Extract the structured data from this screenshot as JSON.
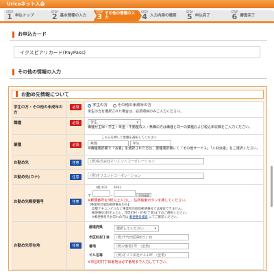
{
  "header": {
    "title": "Uricoネット入会"
  },
  "steps": [
    {
      "label_small": "STEP",
      "num": "1",
      "label": "申込トップ"
    },
    {
      "label_small": "STEP",
      "num": "2",
      "label": "基本情報の入力"
    },
    {
      "label_small": "STEP",
      "num": "3",
      "label": "その他の情報の入力"
    },
    {
      "label_small": "STEP",
      "num": "4",
      "label": "入力内容の確認"
    },
    {
      "label_small": "STEP",
      "num": "5",
      "label": "申込完了"
    },
    {
      "label_small": "STEP",
      "num": "6",
      "label": "審査完了"
    }
  ],
  "card_section": {
    "title": "お申込カード",
    "card_name": "イクスピアリカード(PayPass)"
  },
  "other_section": {
    "title": "その他の情報の入力"
  },
  "work_section": {
    "title": "お勤め先情報について",
    "badges": {
      "required": "必須",
      "optional": "任意"
    },
    "rows": {
      "student": {
        "label": "学生の方・その他の未成年の方",
        "option_on": "学生の方",
        "option_off": "その他の未成年の方",
        "note": "学生の方を選択された場合は、必須項目のみご入力ください。"
      },
      "occupation": {
        "label": "職種",
        "select_value": "学生",
        "note": "職種が主婦・学生・年金・不動産収入・無職の方は職種と同一の業種および税込年収欄をご入力ください。"
      },
      "industry": {
        "label": "業種",
        "hint": "こちらを押して業種を選択してください",
        "value_left": "無職",
        "value_right": "学生",
        "note": "※職種選択欄で「派遣」を選択された方は、業種選択欄にて「その他サービス」「人材派遣」をご選択ください。"
      },
      "company": {
        "label": "お勤め先",
        "placeholder": "(例)株式会社オリエントコーポレーション"
      },
      "company_kana": {
        "label": "お勤め先(カナ)",
        "placeholder": "(例)オリエントコーポレーション"
      },
      "postal": {
        "label": "お勤め先郵便番号",
        "example": "(例)102　　0083",
        "prefix": "〒",
        "dash": "-",
        "search_btn": "住所検索",
        "warn": "※郵便番号を3桁以上入力し、住所検索ボタンを押してください。",
        "notes": [
          "【事業所の個別郵便番号の方】",
          "高層ナチュンビルなど事業所の個別郵便番号では検索できません。",
          "郵便番号3桁を入力し、市区町村・町名(丁目)までのご選択ください。",
          "※郵便番号をお忘れの方は"
        ],
        "link": "郵便番号検索",
        "link_after": "にてご確認ください。"
      },
      "address": {
        "label": "お勤め先所在地",
        "pref_label": "都道府県",
        "pref_placeholder": "選択してください",
        "city_placeholder": "(例)千代田区麹町5丁目",
        "city_label": "市区町村丁目",
        "street_placeholder": "(例)2番地1号　(全角)",
        "street_label": "番地",
        "building_placeholder": "(例)オリコ本社ビル18F　(全角)",
        "building_label": "ビル名等",
        "warn": "※市区町村丁目番地は必ず番地まで入力して下さい。"
      }
    }
  }
}
